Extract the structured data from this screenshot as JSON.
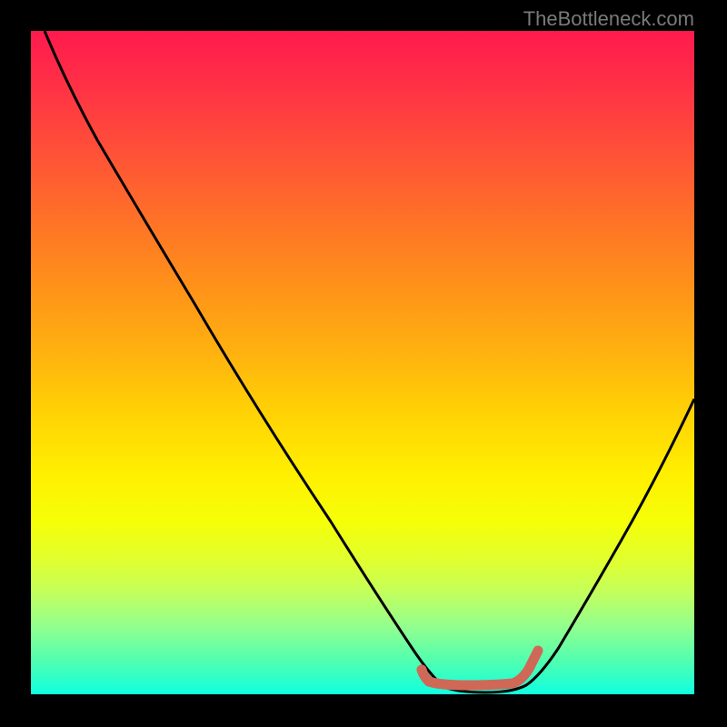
{
  "watermark": "TheBottleneck.com",
  "chart_data": {
    "type": "line",
    "title": "",
    "xlabel": "",
    "ylabel": "",
    "xlim": [
      0,
      100
    ],
    "ylim": [
      0,
      100
    ],
    "series": [
      {
        "name": "bottleneck-curve",
        "x": [
          2,
          5,
          10,
          15,
          20,
          25,
          30,
          35,
          40,
          45,
          50,
          55,
          58,
          60,
          62,
          65,
          68,
          70,
          73,
          76,
          80,
          85,
          90,
          95,
          100
        ],
        "values": [
          100,
          94,
          87,
          80,
          73,
          66,
          58,
          51,
          43,
          35,
          27,
          19,
          13,
          9,
          5,
          2,
          1,
          1,
          1,
          2,
          5,
          12,
          22,
          33,
          45
        ],
        "color": "#000000"
      },
      {
        "name": "optimal-range-marker",
        "x": [
          58,
          60,
          62,
          64,
          66,
          68,
          70,
          72,
          73,
          74
        ],
        "values": [
          3.5,
          2.2,
          1.8,
          1.5,
          1.5,
          1.5,
          1.5,
          1.8,
          3.2,
          5
        ],
        "color": "#d06858"
      }
    ],
    "annotations": []
  }
}
